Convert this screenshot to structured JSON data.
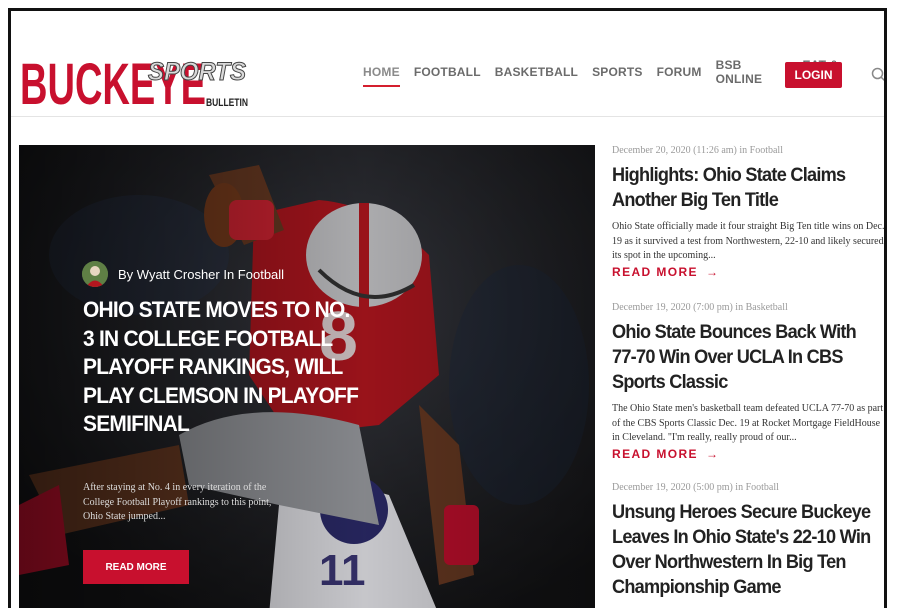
{
  "brand": {
    "name": "BUCKEYE",
    "sub1": "SPORTS",
    "sub2": "BULLETIN"
  },
  "nav": {
    "items": [
      {
        "label": "HOME"
      },
      {
        "label": "FOOTBALL"
      },
      {
        "label": "BASKETBALL"
      },
      {
        "label": "SPORTS"
      },
      {
        "label": "FORUM"
      },
      {
        "label": "BSB ONLINE"
      },
      {
        "label": "EAT & STAY"
      }
    ],
    "login_label": "LOGIN"
  },
  "hero": {
    "byline": "By Wyatt Crosher In Football",
    "title": "OHIO STATE MOVES TO NO. 3 IN COLLEGE FOOTBALL PLAYOFF RANKINGS, WILL PLAY CLEMSON IN PLAYOFF SEMIFINAL",
    "excerpt": "After staying at No. 4 in every iteration of the College Football Playoff rankings to this point, Ohio State jumped...",
    "button": "READ MORE"
  },
  "sidebar": {
    "posts": [
      {
        "meta": "December 20, 2020 (11:26 am) in Football",
        "title": "Highlights: Ohio State Claims Another Big Ten Title",
        "excerpt": "Ohio State officially made it four straight Big Ten title wins on Dec. 19 as it survived a test from Northwestern, 22-10 and likely secured its spot in the upcoming...",
        "readmore": "READ MORE"
      },
      {
        "meta": "December 19, 2020 (7:00 pm) in Basketball",
        "title": "Ohio State Bounces Back With 77-70 Win Over UCLA In CBS Sports Classic",
        "excerpt": "The Ohio State men's basketball team defeated UCLA 77-70 as part of the CBS Sports Classic Dec. 19 at Rocket Mortgage FieldHouse in Cleveland. \"I'm really, really proud of our...",
        "readmore": "READ MORE"
      },
      {
        "meta": "December 19, 2020 (5:00 pm) in Football",
        "title": "Unsung Heroes Secure Buckeye Leaves In Ohio State's 22-10 Win Over Northwestern In Big Ten Championship Game"
      }
    ]
  },
  "colors": {
    "accent": "#c8102e",
    "nav_text": "#6b6b6b",
    "meta_text": "#9a9a9a"
  },
  "icons": {
    "search": "search-icon",
    "arrow": "arrow-right-icon"
  }
}
